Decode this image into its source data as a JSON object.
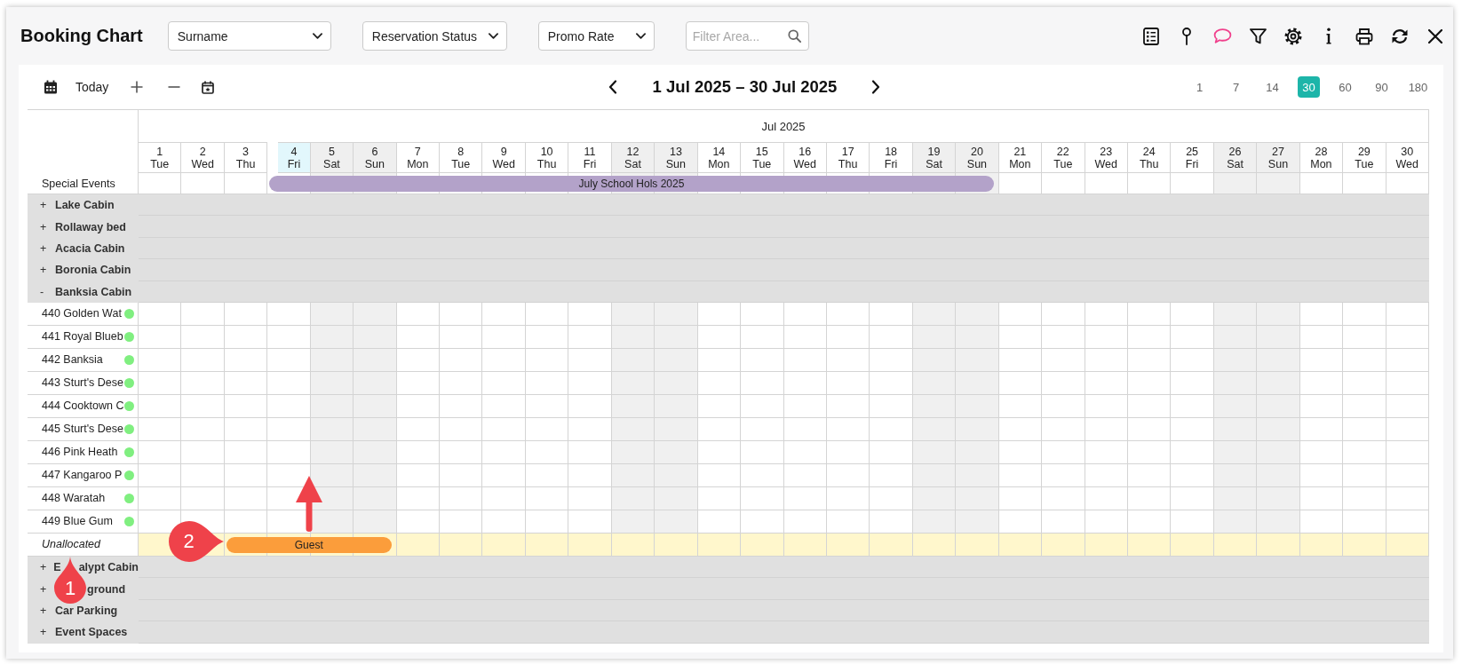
{
  "header": {
    "title": "Booking Chart",
    "dropdowns": [
      {
        "value": "Surname"
      },
      {
        "value": "Reservation Status"
      },
      {
        "value": "Promo Rate"
      }
    ],
    "filter": {
      "placeholder": "Filter Area..."
    }
  },
  "toolbar": {
    "today": "Today",
    "range_title": "1 Jul 2025 – 30 Jul 2025",
    "zoom_options": [
      {
        "label": "1",
        "selected": false
      },
      {
        "label": "7",
        "selected": false
      },
      {
        "label": "14",
        "selected": false
      },
      {
        "label": "30",
        "selected": true
      },
      {
        "label": "60",
        "selected": false
      },
      {
        "label": "90",
        "selected": false
      },
      {
        "label": "180",
        "selected": false
      }
    ]
  },
  "chart": {
    "month": "Jul 2025",
    "days": [
      {
        "day": "1",
        "weekday": "Tue",
        "weekend": false,
        "today": false
      },
      {
        "day": "2",
        "weekday": "Wed",
        "weekend": false,
        "today": false
      },
      {
        "day": "3",
        "weekday": "Thu",
        "weekend": false,
        "today": false
      },
      {
        "day": "4",
        "weekday": "Fri",
        "weekend": false,
        "today": true
      },
      {
        "day": "5",
        "weekday": "Sat",
        "weekend": true,
        "today": false
      },
      {
        "day": "6",
        "weekday": "Sun",
        "weekend": true,
        "today": false
      },
      {
        "day": "7",
        "weekday": "Mon",
        "weekend": false,
        "today": false
      },
      {
        "day": "8",
        "weekday": "Tue",
        "weekend": false,
        "today": false
      },
      {
        "day": "9",
        "weekday": "Wed",
        "weekend": false,
        "today": false
      },
      {
        "day": "10",
        "weekday": "Thu",
        "weekend": false,
        "today": false
      },
      {
        "day": "11",
        "weekday": "Fri",
        "weekend": false,
        "today": false
      },
      {
        "day": "12",
        "weekday": "Sat",
        "weekend": true,
        "today": false
      },
      {
        "day": "13",
        "weekday": "Sun",
        "weekend": true,
        "today": false
      },
      {
        "day": "14",
        "weekday": "Mon",
        "weekend": false,
        "today": false
      },
      {
        "day": "15",
        "weekday": "Tue",
        "weekend": false,
        "today": false
      },
      {
        "day": "16",
        "weekday": "Wed",
        "weekend": false,
        "today": false
      },
      {
        "day": "17",
        "weekday": "Thu",
        "weekend": false,
        "today": false
      },
      {
        "day": "18",
        "weekday": "Fri",
        "weekend": false,
        "today": false
      },
      {
        "day": "19",
        "weekday": "Sat",
        "weekend": true,
        "today": false
      },
      {
        "day": "20",
        "weekday": "Sun",
        "weekend": true,
        "today": false
      },
      {
        "day": "21",
        "weekday": "Mon",
        "weekend": false,
        "today": false
      },
      {
        "day": "22",
        "weekday": "Tue",
        "weekend": false,
        "today": false
      },
      {
        "day": "23",
        "weekday": "Wed",
        "weekend": false,
        "today": false
      },
      {
        "day": "24",
        "weekday": "Thu",
        "weekend": false,
        "today": false
      },
      {
        "day": "25",
        "weekday": "Fri",
        "weekend": false,
        "today": false
      },
      {
        "day": "26",
        "weekday": "Sat",
        "weekend": true,
        "today": false
      },
      {
        "day": "27",
        "weekday": "Sun",
        "weekend": true,
        "today": false
      },
      {
        "day": "28",
        "weekday": "Mon",
        "weekend": false,
        "today": false
      },
      {
        "day": "29",
        "weekday": "Tue",
        "weekend": false,
        "today": false
      },
      {
        "day": "30",
        "weekday": "Wed",
        "weekend": false,
        "today": false
      }
    ],
    "special_events": {
      "label": "Special Events",
      "events": [
        {
          "title": "July School Hols 2025"
        }
      ]
    },
    "groups": [
      {
        "toggle": "+",
        "label": "Lake Cabin"
      },
      {
        "toggle": "+",
        "label": "Rollaway bed"
      },
      {
        "toggle": "+",
        "label": "Acacia Cabin"
      },
      {
        "toggle": "+",
        "label": "Boronia Cabin"
      },
      {
        "toggle": "-",
        "label": "Banksia Cabin",
        "rooms": [
          {
            "name": "440 Golden Wat",
            "color": "#80ef80"
          },
          {
            "name": "441 Royal Blueb",
            "color": "#80ef80"
          },
          {
            "name": "442 Banksia",
            "color": "#80ef80"
          },
          {
            "name": "443 Sturt's Dese",
            "color": "#80ef80"
          },
          {
            "name": "444 Cooktown C",
            "color": "#80ef80"
          },
          {
            "name": "445 Sturt's Dese",
            "color": "#80ef80"
          },
          {
            "name": "446 Pink Heath",
            "color": "#80ef80"
          },
          {
            "name": "447 Kangaroo P",
            "color": "#80ef80"
          },
          {
            "name": "448 Waratah",
            "color": "#80ef80"
          },
          {
            "name": "449 Blue Gum",
            "color": "#80ef80"
          }
        ],
        "unallocated": {
          "label": "Unallocated",
          "bookings": [
            {
              "guest": "Guest"
            }
          ]
        }
      },
      {
        "toggle": "+",
        "label_parts": [
          {
            "kind": "text",
            "text": "E"
          },
          {
            "kind": "gap"
          },
          {
            "kind": "text",
            "text": "alypt Cabin"
          }
        ]
      },
      {
        "toggle": "+",
        "label_parts": [
          {
            "kind": "widegap"
          },
          {
            "kind": "text",
            "text": "ground"
          }
        ]
      },
      {
        "toggle": "+",
        "label": "Car Parking"
      },
      {
        "toggle": "+",
        "label": "Event Spaces"
      }
    ]
  },
  "annotations": [
    {
      "kind": "pin",
      "number": "1"
    },
    {
      "kind": "pin",
      "number": "2"
    },
    {
      "kind": "arrow"
    }
  ]
}
